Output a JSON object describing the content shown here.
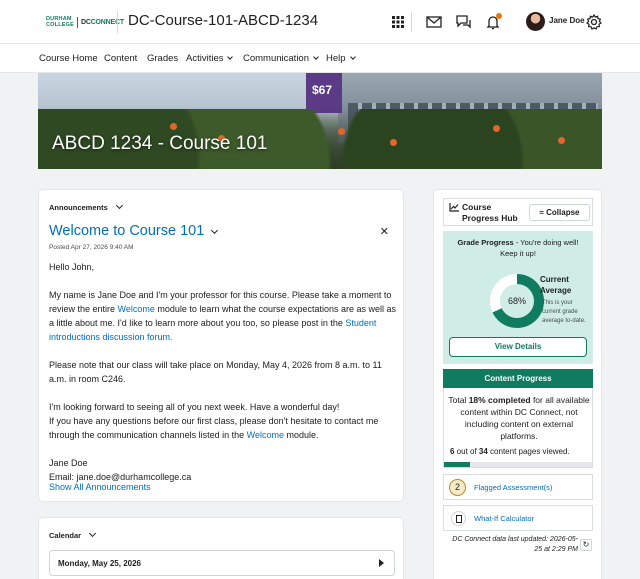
{
  "header": {
    "logo_college": "DURHAM COLLEGE",
    "logo_dc": "DC",
    "logo_connect": "CONNECT",
    "course_title": "DC-Course-101-ABCD-1234",
    "username": "Jane Doe",
    "icons": [
      "apps-grid-icon",
      "mail-icon",
      "chat-icon",
      "bell-icon",
      "gear-icon"
    ]
  },
  "nav": {
    "items": [
      {
        "label": "Course Home"
      },
      {
        "label": "Content"
      },
      {
        "label": "Grades"
      },
      {
        "label": "Activities"
      },
      {
        "label": "Communication"
      },
      {
        "label": "Help"
      }
    ]
  },
  "banner": {
    "title": "ABCD 1234 - Course 101",
    "sign_text": "$67"
  },
  "announcements": {
    "widget_title": "Announcements",
    "title": "Welcome to Course 101",
    "posted": "Posted Apr 27, 2026 9:40 AM",
    "greeting": "Hello John,",
    "p1_a": "My name is Jane Doe and I'm your professor for this course. Please take a moment to review the entire ",
    "p1_link1": "Welcome",
    "p1_b": " module to learn what the course expectations are as well as a little about me. I'd like to learn more about you too, so please post in the ",
    "p1_link2": "Student introductions discussion forum.",
    "p2": "Please note that our class will take place on Monday, May 4, 2026 from 8 a.m. to 11 a.m. in room C246.",
    "p3_line1": "I'm looking forward to seeing all of you next week. Have a wonderful day!",
    "p3_a": "If you have any questions before our first class, please don't hesitate to contact me through the communication channels listed in the ",
    "p3_link": "Welcome",
    "p3_b": " module.",
    "sign_name": "Jane Doe",
    "sign_email": "Email: jane.doe@durhamcollege.ca",
    "show_all": "Show All Announcements"
  },
  "calendar": {
    "widget_title": "Calendar",
    "date": "Monday, May 25, 2026"
  },
  "hub": {
    "title_line1": "Course",
    "title_line2": "Progress Hub",
    "collapse": "Collapse",
    "grade_progress_label": "Grade Progress",
    "grade_progress_msg": " - You're doing well! Keep it up!",
    "current_average": 68,
    "current_average_text": "68%",
    "current_average_title_1": "Current",
    "current_average_title_2": "Average",
    "current_average_desc": "This is your current grade average to-date.",
    "view_details": "View Details",
    "content_progress_title": "Content Progress",
    "total_prefix": "Total ",
    "total_pct": "18% completed",
    "total_suffix": " for all available content within DC Connect, not including content on external platforms.",
    "pages_viewed": 6,
    "pages_total": 34,
    "pages_text_mid": " out of ",
    "pages_text_end": " content pages viewed.",
    "flagged_count": "2",
    "flagged_label": "Flagged Assessment(s)",
    "whatif_label": "What-If Calculator",
    "updated": "DC Connect data last updated: 2026-05-25 at 2:29 PM",
    "accent_color": "#0f7b5f"
  }
}
